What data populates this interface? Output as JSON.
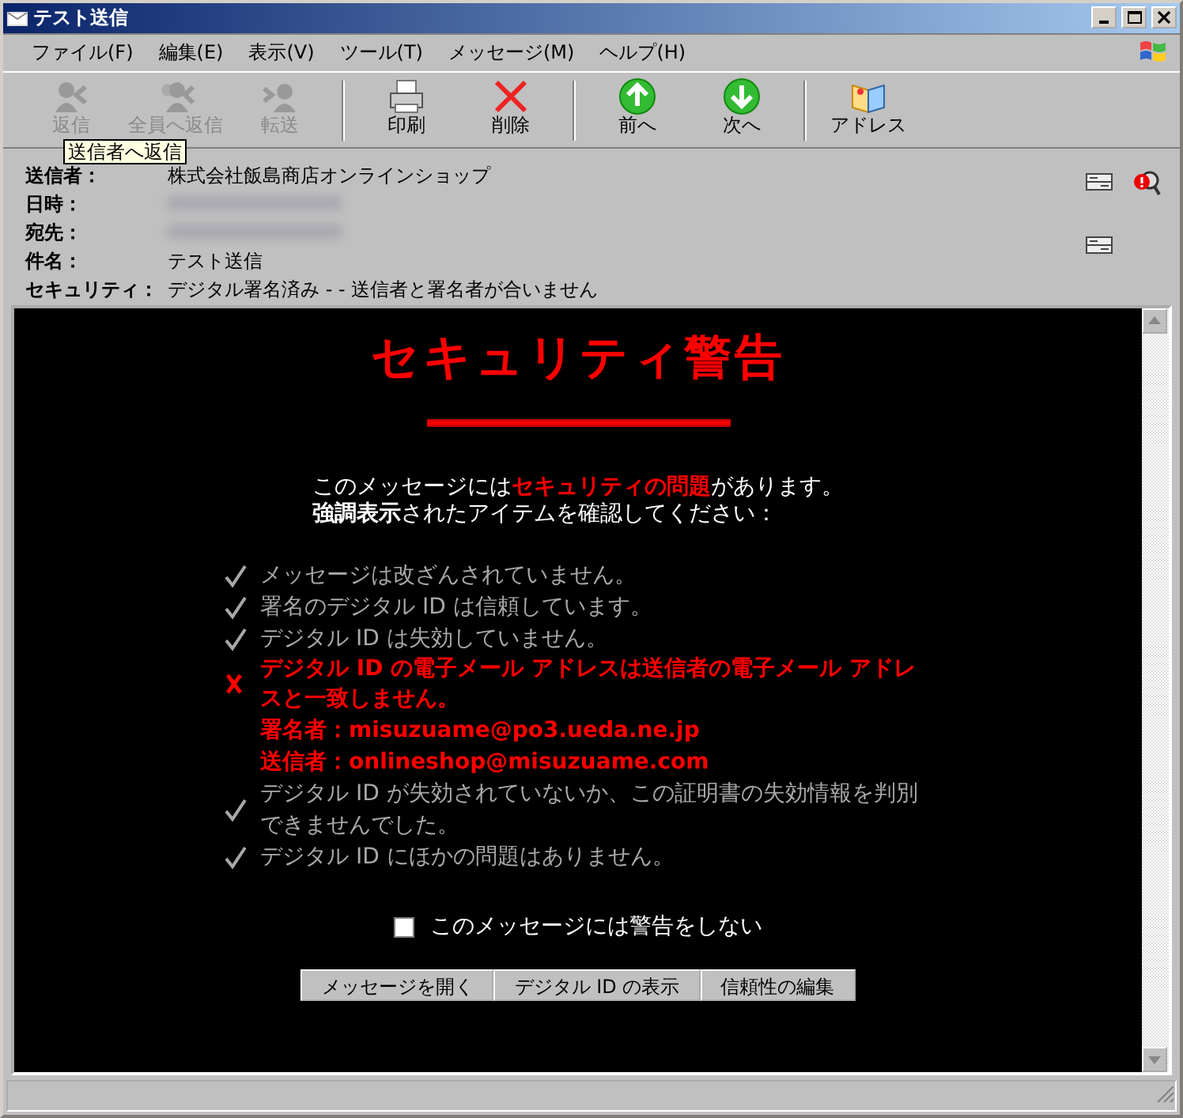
{
  "window": {
    "title": "テスト送信"
  },
  "menu": [
    "ファイル(F)",
    "編集(E)",
    "表示(V)",
    "ツール(T)",
    "メッセージ(M)",
    "ヘルプ(H)"
  ],
  "toolbar": [
    {
      "label": "返信",
      "disabled": true,
      "separator_after": false
    },
    {
      "label": "全員へ返信",
      "disabled": true,
      "separator_after": false
    },
    {
      "label": "転送",
      "disabled": true,
      "separator_after": true
    },
    {
      "label": "印刷",
      "disabled": false,
      "separator_after": false
    },
    {
      "label": "削除",
      "disabled": false,
      "separator_after": true
    },
    {
      "label": "前へ",
      "disabled": false,
      "separator_after": false
    },
    {
      "label": "次へ",
      "disabled": false,
      "separator_after": true
    },
    {
      "label": "アドレス",
      "disabled": false,
      "separator_after": false
    }
  ],
  "tooltip": "送信者へ返信",
  "header": [
    {
      "label": "送信者：",
      "value": "株式会社飯島商店オンラインショップ",
      "redacted": false
    },
    {
      "label": "日時：",
      "redacted": true
    },
    {
      "label": "宛先：",
      "redacted": true
    },
    {
      "label": "件名：",
      "value": "テスト送信",
      "redacted": false
    },
    {
      "label": "セキュリティ：",
      "value": "デジタル署名済み - - 送信者と署名者が合いません",
      "redacted": false
    }
  ],
  "warning": {
    "title": "セキュリティ警告",
    "intro": [
      {
        "text": "このメッセージには**セキュリティの問題**があります。",
        "color": "#ff0000"
      },
      {
        "text": "**強調表示**されたアイテムを確認してください：",
        "color": "#ffffff"
      }
    ],
    "checks": [
      {
        "kind": "ok",
        "text": "メッセージは改ざんされていません。"
      },
      {
        "kind": "ok",
        "text": "署名のデジタル ID は信頼しています。"
      },
      {
        "kind": "ok",
        "text": "デジタル ID は失効していません。"
      },
      {
        "kind": "fail",
        "text": "デジタル ID の電子メール アドレスは送信者の電子メール アドレスと一致しません。"
      },
      {
        "kind": "detail",
        "text": "署名者：misuzuame@po3.ueda.ne.jp"
      },
      {
        "kind": "detail",
        "text": "送信者：onlineshop@misuzuame.com"
      },
      {
        "kind": "ok",
        "text": "デジタル ID が失効されていないか、この証明書の失効情報を判別できませんでした。"
      },
      {
        "kind": "ok",
        "text": "デジタル ID にほかの問題はありません。"
      }
    ],
    "dont_warn": {
      "label": "このメッセージには警告をしない",
      "checked": false
    },
    "buttons": [
      "メッセージを開く",
      "デジタル ID の表示",
      "信頼性の編集"
    ]
  }
}
